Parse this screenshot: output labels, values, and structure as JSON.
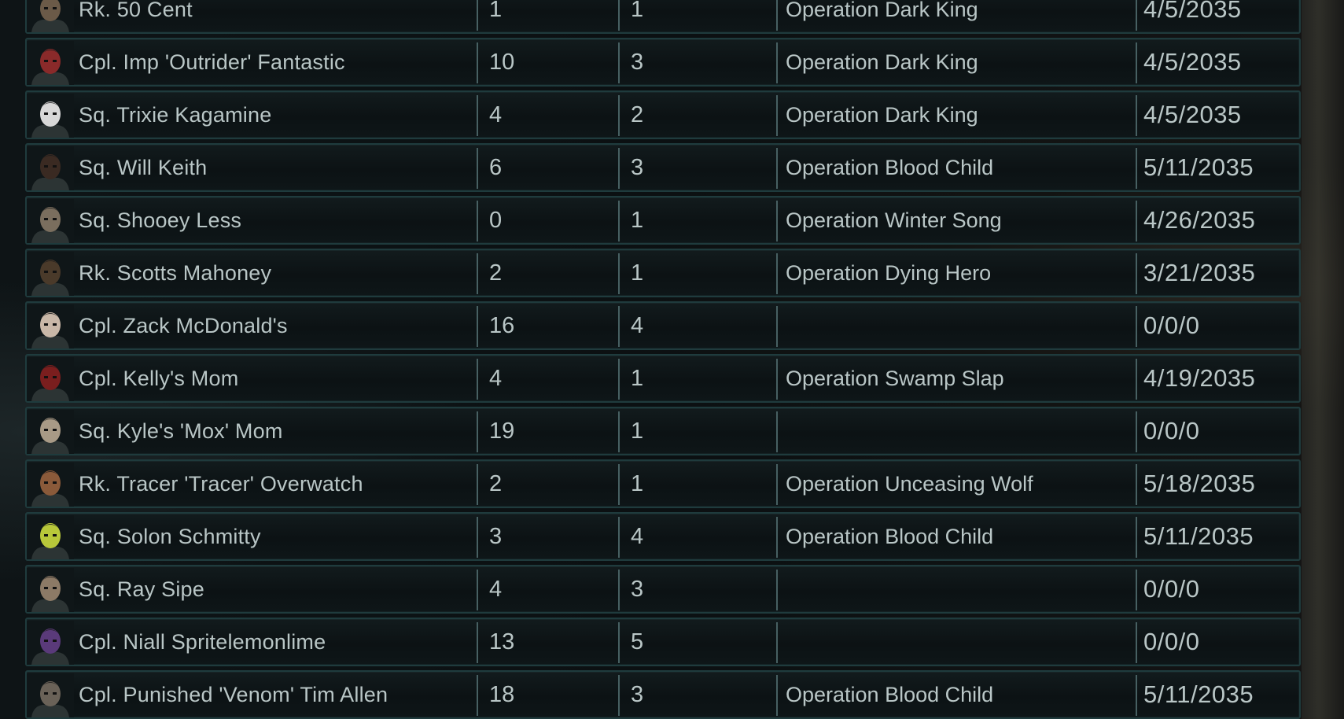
{
  "memorial": {
    "rows": [
      {
        "name": "Rk. 50 Cent",
        "kills": "1",
        "missions": "1",
        "operation": "Operation Dark King",
        "date": "4/5/2035",
        "portrait_color": "#6b5a48"
      },
      {
        "name": "Cpl. Imp 'Outrider' Fantastic",
        "kills": "10",
        "missions": "3",
        "operation": "Operation Dark King",
        "date": "4/5/2035",
        "portrait_color": "#8a2a2a"
      },
      {
        "name": "Sq. Trixie Kagamine",
        "kills": "4",
        "missions": "2",
        "operation": "Operation Dark King",
        "date": "4/5/2035",
        "portrait_color": "#d8d8d8"
      },
      {
        "name": "Sq. Will Keith",
        "kills": "6",
        "missions": "3",
        "operation": "Operation Blood Child",
        "date": "5/11/2035",
        "portrait_color": "#3a2a22"
      },
      {
        "name": "Sq. Shooey Less",
        "kills": "0",
        "missions": "1",
        "operation": "Operation Winter Song",
        "date": "4/26/2035",
        "portrait_color": "#7a6e5e"
      },
      {
        "name": "Rk. Scotts Mahoney",
        "kills": "2",
        "missions": "1",
        "operation": "Operation Dying Hero",
        "date": "3/21/2035",
        "portrait_color": "#4a3a2a"
      },
      {
        "name": "Cpl. Zack McDonald's",
        "kills": "16",
        "missions": "4",
        "operation": "",
        "date": "0/0/0",
        "portrait_color": "#c9b8a8"
      },
      {
        "name": "Cpl. Kelly's Mom",
        "kills": "4",
        "missions": "1",
        "operation": "Operation Swamp Slap",
        "date": "4/19/2035",
        "portrait_color": "#7a1e1e"
      },
      {
        "name": "Sq. Kyle's 'Mox' Mom",
        "kills": "19",
        "missions": "1",
        "operation": "",
        "date": "0/0/0",
        "portrait_color": "#a89a86"
      },
      {
        "name": "Rk. Tracer 'Tracer' Overwatch",
        "kills": "2",
        "missions": "1",
        "operation": "Operation Unceasing Wolf",
        "date": "5/18/2035",
        "portrait_color": "#8a5a3a"
      },
      {
        "name": "Sq. Solon Schmitty",
        "kills": "3",
        "missions": "4",
        "operation": "Operation Blood Child",
        "date": "5/11/2035",
        "portrait_color": "#b8c83a"
      },
      {
        "name": "Sq. Ray Sipe",
        "kills": "4",
        "missions": "3",
        "operation": "",
        "date": "0/0/0",
        "portrait_color": "#8c7a66"
      },
      {
        "name": "Cpl. Niall Spritelemonlime",
        "kills": "13",
        "missions": "5",
        "operation": "",
        "date": "0/0/0",
        "portrait_color": "#5a3a7a"
      },
      {
        "name": "Cpl. Punished 'Venom' Tim Allen",
        "kills": "18",
        "missions": "3",
        "operation": "Operation Blood Child",
        "date": "5/11/2035",
        "portrait_color": "#6a6258"
      }
    ]
  }
}
